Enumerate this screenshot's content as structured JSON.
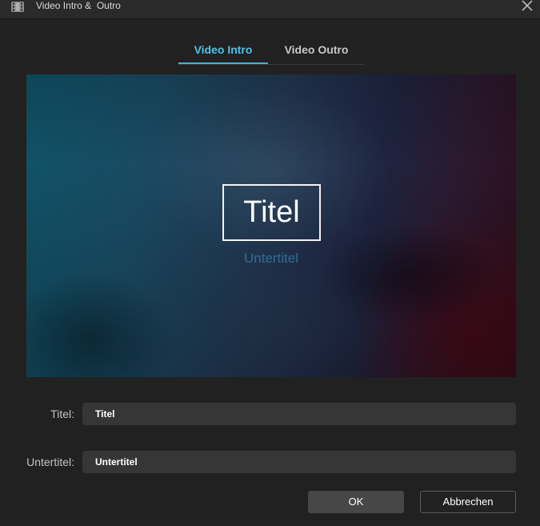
{
  "window": {
    "title": "Video Intro &  Outro",
    "icon": "film-icon",
    "close_icon": "close-icon"
  },
  "tabs": [
    {
      "label": "Video Intro",
      "active": true
    },
    {
      "label": "Video Outro",
      "active": false
    }
  ],
  "preview": {
    "title": "Titel",
    "subtitle": "Untertitel"
  },
  "form": {
    "title_label": "Titel:",
    "title_value": "Titel",
    "subtitle_label": "Untertitel:",
    "subtitle_value": "Untertitel"
  },
  "buttons": {
    "ok": "OK",
    "cancel": "Abbrechen"
  },
  "colors": {
    "accent": "#3ab5df",
    "background": "#212121",
    "input_bg": "#363636"
  }
}
